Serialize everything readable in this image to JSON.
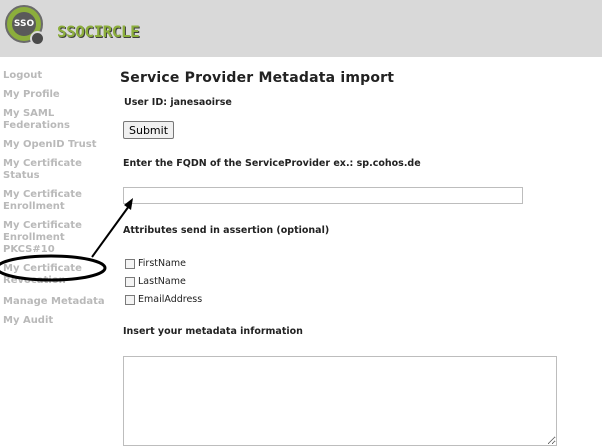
{
  "header": {
    "logo_badge": "SSO",
    "logo_text": "SSOCIRCLE",
    "brand_color": "#8cae3c"
  },
  "sidebar": {
    "items": [
      {
        "label": "Logout"
      },
      {
        "label": "My Profile"
      },
      {
        "label": "My SAML Federations"
      },
      {
        "label": "My OpenID Trust"
      },
      {
        "label": "My Certificate Status"
      },
      {
        "label": "My Certificate Enrollment"
      },
      {
        "label": "My Certificate Enrollment PKCS#10"
      },
      {
        "label": "My Certificate Revocation"
      },
      {
        "label": "Manage Metadata"
      },
      {
        "label": "My Audit"
      }
    ],
    "highlighted_item": "Manage Metadata"
  },
  "main": {
    "title": "Service Provider Metadata import",
    "user_id": "User ID: janesaoirse",
    "submit_label": "Submit",
    "fqdn_label": "Enter the FQDN of the ServiceProvider ex.: sp.cohos.de",
    "fqdn_value": "",
    "attributes_label": "Attributes send in assertion (optional)",
    "attributes": [
      {
        "label": "FirstName",
        "checked": false
      },
      {
        "label": "LastName",
        "checked": false
      },
      {
        "label": "EmailAddress",
        "checked": false
      }
    ],
    "metadata_label": "Insert your metadata information",
    "metadata_value": ""
  }
}
